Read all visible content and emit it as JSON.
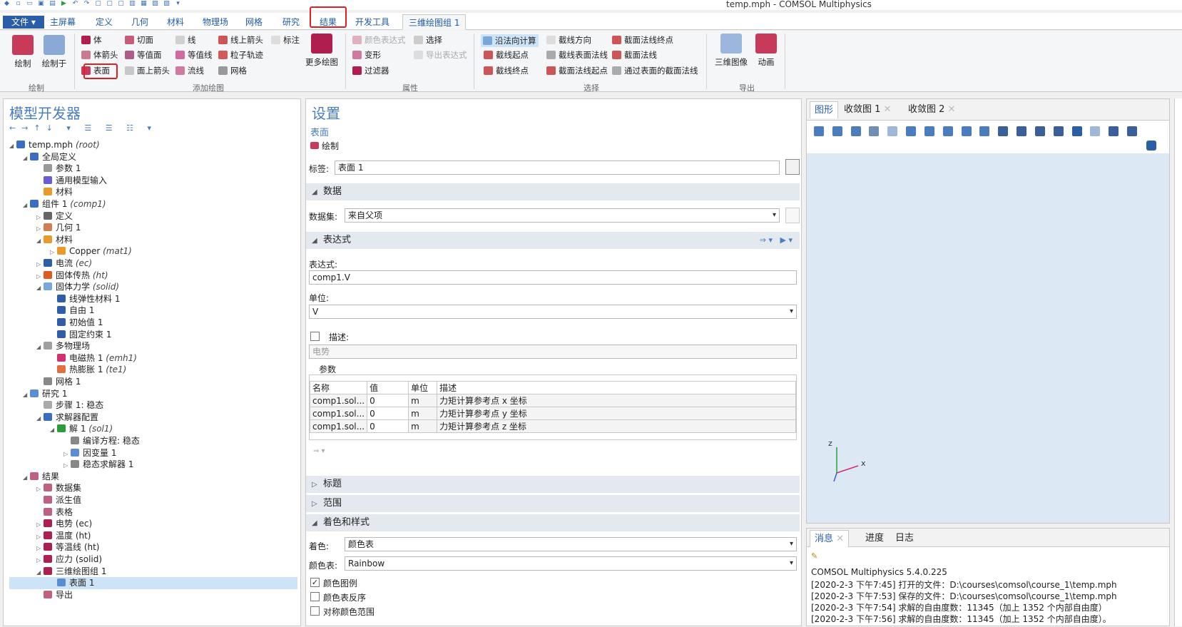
{
  "window": {
    "title": "temp.mph - COMSOL Multiphysics"
  },
  "tabs": [
    {
      "label": "文件 ▾"
    },
    {
      "label": "主屏幕"
    },
    {
      "label": "定义"
    },
    {
      "label": "几何"
    },
    {
      "label": "材料"
    },
    {
      "label": "物理场"
    },
    {
      "label": "网格"
    },
    {
      "label": "研究"
    },
    {
      "label": "结果"
    },
    {
      "label": "开发工具"
    },
    {
      "label": "三维绘图组 1"
    }
  ],
  "ribbon": {
    "plot": {
      "draw": "绘制",
      "draw_in": "绘制于",
      "group": "绘制"
    },
    "add": {
      "items": [
        "体",
        "切面",
        "线",
        "线上箭头",
        "标注",
        "体箭头",
        "等值面",
        "等值线",
        "粒子轨迹",
        "表面",
        "面上箭头",
        "流线",
        "网格"
      ],
      "more": "更多绘图",
      "group": "添加绘图"
    },
    "attr": {
      "items": [
        "颜色表达式",
        "选择",
        "变形",
        "导出表达式",
        "过滤器"
      ],
      "group": "属性"
    },
    "select": {
      "items": [
        "沿法向计算",
        "截线方向",
        "截面法线终点",
        "截线起点",
        "截线表面法线",
        "截面法线",
        "截线终点",
        "截面法线起点",
        "通过表面的截面法线"
      ],
      "group": "选择"
    },
    "export": {
      "img3d": "三维图像",
      "anim": "动画",
      "group": "导出"
    }
  },
  "model": {
    "title": "模型开发器",
    "tree": [
      {
        "t": "temp.mph ",
        "i": "(root)",
        "lv": 0,
        "tw": "◢"
      },
      {
        "t": "全局定义",
        "lv": 1,
        "tw": "◢"
      },
      {
        "t": "参数 1",
        "lv": 2,
        "tw": ""
      },
      {
        "t": "通用模型输入",
        "lv": 2,
        "tw": ""
      },
      {
        "t": "材料",
        "lv": 2,
        "tw": ""
      },
      {
        "t": "组件 1 ",
        "i": "(comp1)",
        "lv": 1,
        "tw": "◢"
      },
      {
        "t": "定义",
        "lv": 2,
        "tw": "▷"
      },
      {
        "t": "几何 1",
        "lv": 2,
        "tw": "▷"
      },
      {
        "t": "材料",
        "lv": 2,
        "tw": "◢"
      },
      {
        "t": "Copper ",
        "i": "(mat1)",
        "lv": 3,
        "tw": "▷"
      },
      {
        "t": "电流 ",
        "i": "(ec)",
        "lv": 2,
        "tw": "▷"
      },
      {
        "t": "固体传热 ",
        "i": "(ht)",
        "lv": 2,
        "tw": "▷"
      },
      {
        "t": "固体力学 ",
        "i": "(solid)",
        "lv": 2,
        "tw": "◢"
      },
      {
        "t": "线弹性材料 1",
        "lv": 3,
        "tw": ""
      },
      {
        "t": "自由 1",
        "lv": 3,
        "tw": ""
      },
      {
        "t": "初始值 1",
        "lv": 3,
        "tw": ""
      },
      {
        "t": "固定约束 1",
        "lv": 3,
        "tw": ""
      },
      {
        "t": "多物理场",
        "lv": 2,
        "tw": "◢"
      },
      {
        "t": "电磁热 1 ",
        "i": "(emh1)",
        "lv": 3,
        "tw": ""
      },
      {
        "t": "热膨胀 1 ",
        "i": "(te1)",
        "lv": 3,
        "tw": ""
      },
      {
        "t": "网格 1",
        "lv": 2,
        "tw": ""
      },
      {
        "t": "研究 1",
        "lv": 1,
        "tw": "◢"
      },
      {
        "t": "步骤 1: 稳态",
        "lv": 2,
        "tw": ""
      },
      {
        "t": "求解器配置",
        "lv": 2,
        "tw": "◢"
      },
      {
        "t": "解 1 ",
        "i": "(sol1)",
        "lv": 3,
        "tw": "◢"
      },
      {
        "t": "编译方程: 稳态",
        "lv": 4,
        "tw": ""
      },
      {
        "t": "因变量 1",
        "lv": 4,
        "tw": "▷"
      },
      {
        "t": "稳态求解器 1",
        "lv": 4,
        "tw": "▷"
      },
      {
        "t": "结果",
        "lv": 1,
        "tw": "◢"
      },
      {
        "t": "数据集",
        "lv": 2,
        "tw": "▷"
      },
      {
        "t": "派生值",
        "lv": 2,
        "tw": ""
      },
      {
        "t": "表格",
        "lv": 2,
        "tw": ""
      },
      {
        "t": "电势 (ec)",
        "lv": 2,
        "tw": "▷"
      },
      {
        "t": "温度 (ht)",
        "lv": 2,
        "tw": "▷"
      },
      {
        "t": "等温线 (ht)",
        "lv": 2,
        "tw": "▷"
      },
      {
        "t": "应力 (solid)",
        "lv": 2,
        "tw": "▷"
      },
      {
        "t": "三维绘图组 1",
        "lv": 2,
        "tw": "◢"
      },
      {
        "t": "表面 1",
        "lv": 3,
        "tw": "",
        "sel": true
      },
      {
        "t": "导出",
        "lv": 2,
        "tw": ""
      }
    ]
  },
  "settings": {
    "title": "设置",
    "subtitle": "表面",
    "draw": "绘制",
    "label_key": "标签:",
    "label_value": "表面 1",
    "data_section": "数据",
    "dataset_key": "数据集:",
    "dataset_value": "来自父项",
    "expr_section": "表达式",
    "expr_key": "表达式:",
    "expr_value": "comp1.V",
    "unit_key": "单位:",
    "unit_value": "V",
    "desc_key": "描述:",
    "desc_value": "电势",
    "params_key": "参数",
    "table_headers": [
      "名称",
      "值",
      "单位",
      "描述"
    ],
    "table_rows": [
      [
        "comp1.sol...",
        "0",
        "m",
        "力矩计算参考点 x 坐标"
      ],
      [
        "comp1.sol...",
        "0",
        "m",
        "力矩计算参考点 y 坐标"
      ],
      [
        "comp1.sol...",
        "0",
        "m",
        "力矩计算参考点 z 坐标"
      ]
    ],
    "title_section": "标题",
    "range_section": "范围",
    "color_section": "着色和样式",
    "coloring_key": "着色:",
    "coloring_value": "颜色表",
    "colortable_key": "颜色表:",
    "colortable_value": "Rainbow",
    "legend": "颜色图例",
    "reverse": "颜色表反序",
    "symmetric": "对称颜色范围"
  },
  "graphics": {
    "tabs": [
      "图形",
      "收敛图 1",
      "收敛图 2"
    ],
    "axis_z": "z",
    "axis_x": "x"
  },
  "messages": {
    "tabs": [
      "消息",
      "进度",
      "日志"
    ],
    "lines": [
      "COMSOL Multiphysics 5.4.0.225",
      "[2020-2-3 下午7:45] 打开的文件：D:\\courses\\comsol\\course_1\\temp.mph",
      "[2020-2-3 下午7:53] 保存的文件：D:\\courses\\comsol\\course_1\\temp.mph",
      "[2020-2-3 下午7:54] 求解的自由度数：11345（加上 1352 个内部自由度）",
      "[2020-2-3 下午7:56] 求解的自由度数：11345（加上 1352 个内部自由度）。"
    ]
  },
  "colors": {
    "accent": "#2b5ea8",
    "highlight": "#e02020",
    "graphics_bg": "#dde8f5"
  }
}
